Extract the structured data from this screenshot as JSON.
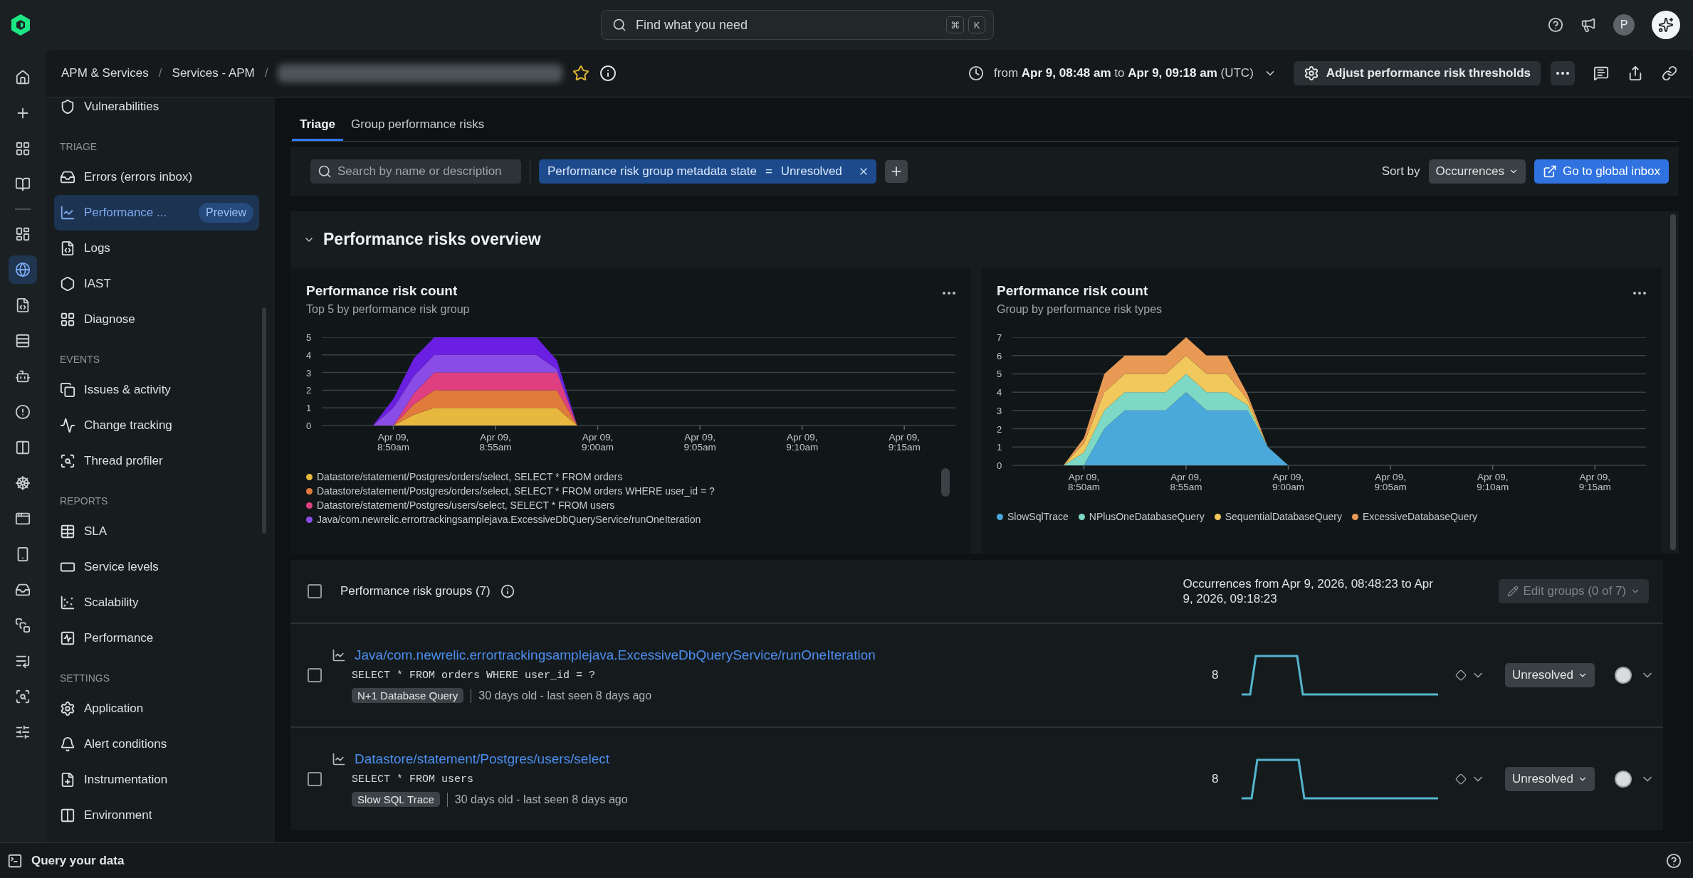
{
  "top_bar": {
    "search": {
      "placeholder": "Find what you need",
      "keys": [
        "⌘",
        "K"
      ]
    },
    "avatar": "P"
  },
  "rail": [
    {
      "selected": false
    },
    {
      "selected": false
    },
    {
      "selected": false
    },
    {
      "selected": false
    },
    {
      "selected": false
    },
    {
      "selected": true
    },
    {
      "selected": false
    },
    {
      "selected": false
    },
    {
      "selected": false
    },
    {
      "selected": false
    },
    {
      "selected": false
    },
    {
      "selected": false
    },
    {
      "selected": false
    },
    {
      "selected": false
    },
    {
      "selected": false
    },
    {
      "selected": false
    },
    {
      "selected": false
    },
    {
      "selected": false
    },
    {
      "selected": false
    }
  ],
  "breadcrumbs": [
    {
      "label": "APM & Services",
      "separator": "/"
    },
    {
      "label": "Services - APM",
      "separator": "/"
    }
  ],
  "time_range": "from **Apr 9, 08:48 am** to **Apr 9, 09:18 am** (UTC)",
  "adjust_button": "Adjust performance risk thresholds",
  "sidebar": {
    "sections": [
      {
        "items": [
          {
            "label": "Vulnerabilities",
            "selected": false
          }
        ]
      },
      {
        "title": "TRIAGE",
        "items": [
          {
            "label": "Errors (errors inbox)",
            "selected": false
          },
          {
            "label": "Performance ...",
            "badge": "Preview",
            "selected": true
          },
          {
            "label": "Logs",
            "selected": false
          },
          {
            "label": "IAST",
            "selected": false
          },
          {
            "label": "Diagnose",
            "selected": false
          }
        ]
      },
      {
        "title": "EVENTS",
        "items": [
          {
            "label": "Issues & activity",
            "selected": false
          },
          {
            "label": "Change tracking",
            "selected": false
          },
          {
            "label": "Thread profiler",
            "selected": false
          }
        ]
      },
      {
        "title": "REPORTS",
        "items": [
          {
            "label": "SLA",
            "selected": false
          },
          {
            "label": "Service levels",
            "selected": false
          },
          {
            "label": "Scalability",
            "selected": false
          },
          {
            "label": "Performance",
            "selected": false
          }
        ]
      },
      {
        "title": "SETTINGS",
        "items": [
          {
            "label": "Application",
            "selected": false
          },
          {
            "label": "Alert conditions",
            "selected": false
          },
          {
            "label": "Instrumentation",
            "selected": false
          },
          {
            "label": "Environment",
            "selected": false
          }
        ]
      }
    ]
  },
  "tabs": [
    {
      "label": "Triage",
      "selected": true
    },
    {
      "label": "Group performance risks",
      "selected": false
    }
  ],
  "filter": {
    "search_placeholder": "Search by name or description",
    "chip": {
      "key": "Performance risk group metadata state",
      "operator": "=",
      "value": "Unresolved"
    },
    "sort_label": "Sort by",
    "sort_value": "Occurrences",
    "inbox_button": "Go to global inbox"
  },
  "overview": {
    "title": "Performance risks overview",
    "expanded": true,
    "charts": [
      {
        "title": "Performance risk count",
        "subtitle": "Top 5 by performance risk group",
        "chart_data": {
          "type": "area",
          "stacked": true,
          "grid": true,
          "ylim": [
            0,
            5
          ],
          "yticks": [
            0,
            1,
            2,
            3,
            4,
            5
          ],
          "categories": [
            null,
            null,
            null,
            "Apr 09, 8:50am",
            null,
            null,
            null,
            null,
            "Apr 09, 8:55am",
            null,
            null,
            null,
            null,
            "Apr 09, 9:00am",
            null,
            null,
            null,
            null,
            "Apr 09, 9:05am",
            null,
            null,
            null,
            null,
            "Apr 09, 9:10am",
            null,
            null,
            null,
            null,
            "Apr 09, 9:15am",
            null,
            null
          ],
          "series": [
            {
              "name": "Datastore/statement/Postgres/orders/select, SELECT * FROM orders",
              "color": "#e8b73d",
              "values": [
                0,
                0,
                0,
                0,
                0.6,
                1,
                1,
                1,
                1,
                1,
                1,
                1,
                0,
                0,
                0,
                0,
                0,
                0,
                0,
                0,
                0,
                0,
                0,
                0,
                0,
                0,
                0,
                0,
                0,
                0,
                0
              ]
            },
            {
              "name": "Datastore/statement/Postgres/orders/select, SELECT * FROM orders WHERE user_id = ?",
              "color": "#e07b3c",
              "values": [
                0,
                0,
                0,
                0,
                0.6,
                1,
                1,
                1,
                1,
                1,
                1,
                1,
                0,
                0,
                0,
                0,
                0,
                0,
                0,
                0,
                0,
                0,
                0,
                0,
                0,
                0,
                0,
                0,
                0,
                0,
                0
              ]
            },
            {
              "name": "Datastore/statement/Postgres/users/select, SELECT * FROM users",
              "color": "#df3f80",
              "values": [
                0,
                0,
                0,
                0,
                0.6,
                1,
                1,
                1,
                1,
                1,
                1,
                1,
                0,
                0,
                0,
                0,
                0,
                0,
                0,
                0,
                0,
                0,
                0,
                0,
                0,
                0,
                0,
                0,
                0,
                0,
                0
              ]
            },
            {
              "name": "Java/com.newrelic.errortrackingsamplejava.ExcessiveDbQueryService/runOneIteration",
              "color": "#8a4ce6",
              "values": [
                0,
                0,
                0,
                1,
                1,
                1,
                1,
                1,
                1,
                1,
                1,
                0.2,
                0,
                0,
                0,
                0,
                0,
                0,
                0,
                0,
                0,
                0,
                0,
                0,
                0,
                0,
                0,
                0,
                0,
                0,
                0
              ]
            },
            {
              "color": "#6a1fe2",
              "values": [
                0,
                0,
                0,
                0.5,
                1,
                1,
                1,
                1,
                1,
                1,
                1,
                0.5,
                0,
                0,
                0,
                0,
                0,
                0,
                0,
                0,
                0,
                0,
                0,
                0,
                0,
                0,
                0,
                0,
                0,
                0,
                0
              ]
            }
          ]
        }
      },
      {
        "title": "Performance risk count",
        "subtitle": "Group by performance risk types",
        "chart_data": {
          "type": "area",
          "stacked": true,
          "grid": true,
          "ylim": [
            0,
            7
          ],
          "yticks": [
            0,
            1,
            2,
            3,
            4,
            5,
            6,
            7
          ],
          "categories": [
            null,
            null,
            null,
            "Apr 09, 8:50am",
            null,
            null,
            null,
            null,
            "Apr 09, 8:55am",
            null,
            null,
            null,
            null,
            "Apr 09, 9:00am",
            null,
            null,
            null,
            null,
            "Apr 09, 9:05am",
            null,
            null,
            null,
            null,
            "Apr 09, 9:10am",
            null,
            null,
            null,
            null,
            "Apr 09, 9:15am",
            null,
            null
          ],
          "series": [
            {
              "name": "SlowSqlTrace",
              "color": "#4aa8da",
              "values": [
                0,
                0,
                0,
                0,
                2,
                3,
                3,
                3,
                4,
                3,
                3,
                3,
                1,
                0,
                0,
                0,
                0,
                0,
                0,
                0,
                0,
                0,
                0,
                0,
                0,
                0,
                0,
                0,
                0,
                0,
                0
              ]
            },
            {
              "name": "NPlusOneDatabaseQuery",
              "color": "#7dd8c5",
              "values": [
                0,
                0,
                0,
                0.7,
                1,
                1,
                1,
                1,
                1,
                1,
                1,
                0.3,
                0,
                0,
                0,
                0,
                0,
                0,
                0,
                0,
                0,
                0,
                0,
                0,
                0,
                0,
                0,
                0,
                0,
                0,
                0
              ]
            },
            {
              "name": "SequentialDatabaseQuery",
              "color": "#f0c85c",
              "values": [
                0,
                0,
                0,
                0.5,
                1,
                1,
                1,
                1,
                1,
                1,
                1,
                0.3,
                0,
                0,
                0,
                0,
                0,
                0,
                0,
                0,
                0,
                0,
                0,
                0,
                0,
                0,
                0,
                0,
                0,
                0,
                0
              ]
            },
            {
              "name": "ExcessiveDatabaseQuery",
              "color": "#e89a55",
              "values": [
                0,
                0,
                0,
                0.3,
                1,
                1,
                1,
                1,
                1,
                1,
                1,
                0.3,
                0,
                0,
                0,
                0,
                0,
                0,
                0,
                0,
                0,
                0,
                0,
                0,
                0,
                0,
                0,
                0,
                0,
                0,
                0
              ]
            }
          ]
        }
      }
    ]
  },
  "groups": {
    "checked": false,
    "title": "Performance risk groups (7)",
    "occurrences": "Occurrences from Apr 9, 2026, 08:48:23 to Apr 9, 2026, 09:18:23",
    "edit_button": {
      "label": "Edit groups (0 of 7)",
      "disabled": true
    },
    "rows": [
      {
        "checked": false,
        "title": "Java/com.newrelic.errortrackingsamplejava.ExcessiveDbQueryService/runOneIteration",
        "query": "SELECT * FROM orders WHERE user_id = ?",
        "tag": "N+1 Database Query",
        "age": "30 days old - last seen 8 days ago",
        "count": "8",
        "status": "Unresolved"
      },
      {
        "checked": false,
        "title": "Datastore/statement/Postgres/users/select",
        "query": "SELECT * FROM users",
        "tag": "Slow SQL Trace",
        "age": "30 days old - last seen 8 days ago",
        "count": "8",
        "status": "Unresolved"
      }
    ]
  },
  "bottom_bar": {
    "label": "Query your data"
  }
}
